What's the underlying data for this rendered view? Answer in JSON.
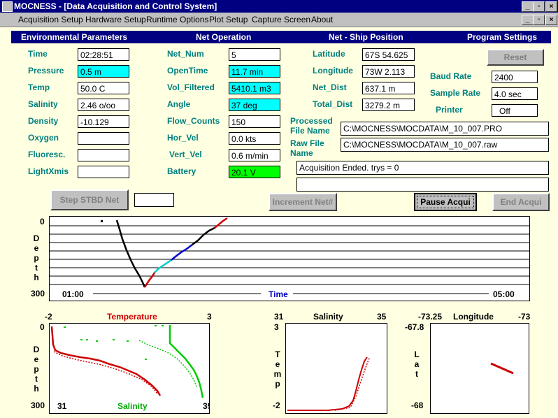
{
  "window": {
    "title": "MOCNESS - [Data Acquisition and Control System]"
  },
  "menu": [
    "Acquisition Setup",
    "Hardware Setup",
    "Runtime Options",
    "Plot Setup",
    "Capture Screen",
    "About"
  ],
  "sections": {
    "env": "Environmental Parameters",
    "net": "Net Operation",
    "pos": "Net - Ship Position",
    "settings": "Program Settings"
  },
  "env": {
    "time": {
      "label": "Time",
      "value": "02:28:51"
    },
    "pressure": {
      "label": "Pressure",
      "value": "0.5 m"
    },
    "temp": {
      "label": "Temp",
      "value": "50.0 C"
    },
    "salinity": {
      "label": "Salinity",
      "value": "2.46 o/oo"
    },
    "density": {
      "label": "Density",
      "value": "-10.129"
    },
    "oxygen": {
      "label": "Oxygen",
      "value": ""
    },
    "fluoresc": {
      "label": "Fluoresc.",
      "value": ""
    },
    "lightxmis": {
      "label": "LightXmis",
      "value": ""
    }
  },
  "net": {
    "net_num": {
      "label": "Net_Num",
      "value": "5"
    },
    "opentime": {
      "label": "OpenTime",
      "value": "11.7 min"
    },
    "vol_filtered": {
      "label": "Vol_Filtered",
      "value": "5410.1 m3"
    },
    "angle": {
      "label": "Angle",
      "value": "37 deg"
    },
    "flow_counts": {
      "label": "Flow_Counts",
      "value": "150"
    },
    "hor_vel": {
      "label": "Hor_Vel",
      "value": "0.0 kts"
    },
    "vert_vel": {
      "label": "Vert_Vel",
      "value": "0.6 m/min"
    },
    "battery": {
      "label": "Battery",
      "value": "20.1 V"
    }
  },
  "pos": {
    "latitude": {
      "label": "Latitude",
      "value": "67S 54.625"
    },
    "longitude": {
      "label": "Longitude",
      "value": "73W 2.113"
    },
    "net_dist": {
      "label": "Net_Dist",
      "value": "637.1 m"
    },
    "total_dist": {
      "label": "Total_Dist",
      "value": "3279.2 m"
    }
  },
  "settings": {
    "reset": "Reset",
    "baud": {
      "label": "Baud Rate",
      "value": "2400"
    },
    "sample": {
      "label": "Sample Rate",
      "value": "4.0 sec"
    },
    "printer": {
      "label": "Printer",
      "value": "Off"
    }
  },
  "files": {
    "processed_label": "Processed File Name",
    "processed_value": "C:\\MOCNESS\\MOCDATA\\M_10_007.PRO",
    "raw_label": "Raw File Name",
    "raw_value": "C:\\MOCNESS\\MOCDATA\\M_10_007.raw",
    "status": "Acquisition Ended. trys = 0",
    "status2": ""
  },
  "buttons": {
    "step": "Step STBD Net",
    "step_field": "",
    "increment": "Increment Net#",
    "pause": "Pause Acqui",
    "end": "End Acqui"
  },
  "depth_plot": {
    "y_top": "0",
    "y_bottom": "300",
    "y_label": "Depth",
    "x_start": "01:00",
    "x_end": "05:00",
    "x_label": "Time"
  },
  "ts_plot": {
    "t_min": "-2",
    "t_label": "Temperature",
    "t_max": "3",
    "d_top": "0",
    "d_bottom": "300",
    "d_label": "Depth",
    "s_min": "31",
    "s_label": "Salinity",
    "s_max": "35"
  },
  "st_plot": {
    "s_min": "31",
    "s_label": "Salinity",
    "s_max": "35",
    "t_top": "3",
    "t_bottom": "-2",
    "t_label": "Temp"
  },
  "ll_plot": {
    "lon_min": "-73.25",
    "lon_label": "Longitude",
    "lon_max": "-73",
    "lat_top": "-67.8",
    "lat_bottom": "-68",
    "lat_label": "Lat"
  },
  "colors": {
    "title_bar": "#000080",
    "label": "#008080",
    "temperature": "#cc0000",
    "salinity": "#00cc00",
    "depth_trace": "#000000",
    "time_label": "#0000c0"
  }
}
